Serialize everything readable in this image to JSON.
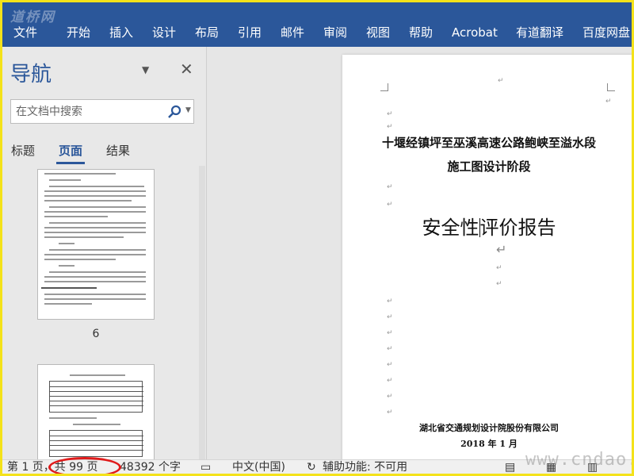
{
  "watermark_top": "道桥网",
  "watermark_bottom": "www.cndao.com",
  "menu": [
    "文件",
    "开始",
    "插入",
    "设计",
    "布局",
    "引用",
    "邮件",
    "审阅",
    "视图",
    "帮助",
    "Acrobat",
    "有道翻译",
    "百度网盘"
  ],
  "nav": {
    "title": "导航",
    "search_placeholder": "在文档中搜索",
    "tabs": [
      "标题",
      "页面",
      "结果"
    ],
    "active_tab": "页面",
    "thumb_page_number": "6"
  },
  "document": {
    "title_line1": "十堰经镇坪至巫溪高速公路鲍峡至溢水段",
    "title_line2": "施工图设计阶段",
    "main_title_a": "安全性",
    "main_title_b": "评价报告",
    "company": "湖北省交通规划设计院股份有限公司",
    "date": "2018 年 1 月"
  },
  "status": {
    "page": "第 1 页，共 99 页",
    "words": "48392 个字",
    "language": "中文(中国)",
    "accessibility": "辅助功能: 不可用"
  },
  "colors": {
    "ribbon": "#2b579a",
    "annotation": "#e01b1b",
    "frame": "#f4e21a"
  }
}
